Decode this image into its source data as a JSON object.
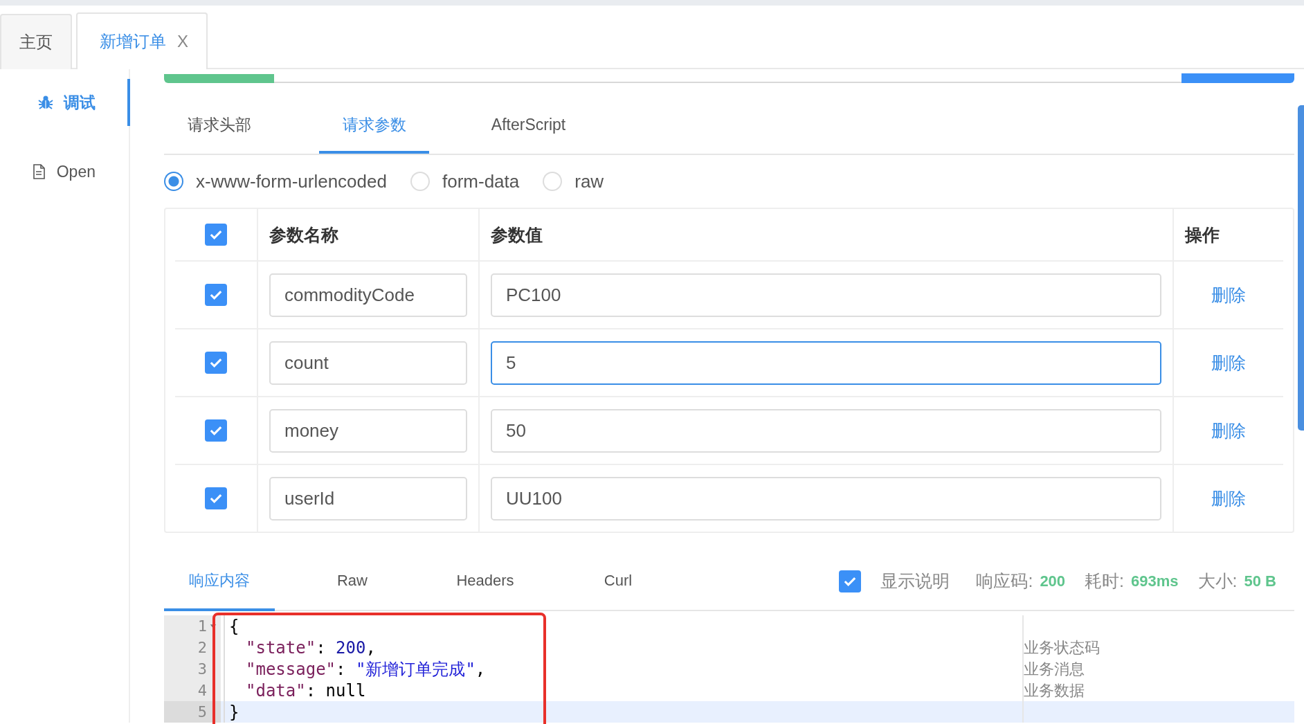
{
  "tabs": [
    {
      "label": "主页",
      "selected": false
    },
    {
      "label": "新增订单",
      "selected": true,
      "close": "X"
    }
  ],
  "sidebar": {
    "items": [
      {
        "label": "调试",
        "selected": true
      },
      {
        "label": "Open",
        "selected": false
      }
    ]
  },
  "request_tabs": [
    {
      "label": "请求头部",
      "selected": false
    },
    {
      "label": "请求参数",
      "selected": true
    },
    {
      "label": "AfterScript",
      "selected": false
    }
  ],
  "body_types": [
    {
      "label": "x-www-form-urlencoded",
      "selected": true
    },
    {
      "label": "form-data",
      "selected": false
    },
    {
      "label": "raw",
      "selected": false
    }
  ],
  "params": {
    "all_checked": true,
    "columns": [
      "参数名称",
      "参数值",
      "操作"
    ],
    "rows": [
      {
        "checked": true,
        "name": "commodityCode",
        "value": "PC100",
        "focused": false,
        "action": "删除"
      },
      {
        "checked": true,
        "name": "count",
        "value": "5",
        "focused": true,
        "action": "删除"
      },
      {
        "checked": true,
        "name": "money",
        "value": "50",
        "focused": false,
        "action": "删除"
      },
      {
        "checked": true,
        "name": "userId",
        "value": "UU100",
        "focused": false,
        "action": "删除"
      }
    ]
  },
  "response_tabs": [
    {
      "label": "响应内容",
      "selected": true
    },
    {
      "label": "Raw",
      "selected": false
    },
    {
      "label": "Headers",
      "selected": false
    },
    {
      "label": "Curl",
      "selected": false
    }
  ],
  "response_meta": {
    "show_notes": {
      "label": "显示说明",
      "checked": true
    },
    "stats": [
      {
        "label": "响应码:",
        "value": "200"
      },
      {
        "label": "耗时:",
        "value": "693ms"
      },
      {
        "label": "大小:",
        "value": "50 B"
      }
    ]
  },
  "editor": {
    "lines": [
      {
        "number": "1",
        "foldable": true,
        "active": false,
        "tokens": [
          {
            "kind": "punct",
            "text": "{"
          }
        ]
      },
      {
        "number": "2",
        "foldable": false,
        "active": false,
        "tokens": [
          {
            "kind": "key",
            "text": "\"state\""
          },
          {
            "kind": "punct",
            "text": ": "
          },
          {
            "kind": "number",
            "text": "200"
          },
          {
            "kind": "punct",
            "text": ","
          }
        ],
        "note": "业务状态码"
      },
      {
        "number": "3",
        "foldable": false,
        "active": false,
        "tokens": [
          {
            "kind": "key",
            "text": "\"message\""
          },
          {
            "kind": "punct",
            "text": ": "
          },
          {
            "kind": "string",
            "text": "\"新增订单完成\""
          },
          {
            "kind": "punct",
            "text": ","
          }
        ],
        "note": "业务消息"
      },
      {
        "number": "4",
        "foldable": false,
        "active": false,
        "tokens": [
          {
            "kind": "key",
            "text": "\"data\""
          },
          {
            "kind": "punct",
            "text": ": "
          },
          {
            "kind": "keyword",
            "text": "null"
          }
        ],
        "note": "业务数据"
      },
      {
        "number": "5",
        "foldable": false,
        "active": true,
        "tokens": [
          {
            "kind": "punct",
            "text": "}"
          }
        ]
      }
    ],
    "highlight_box": true
  }
}
